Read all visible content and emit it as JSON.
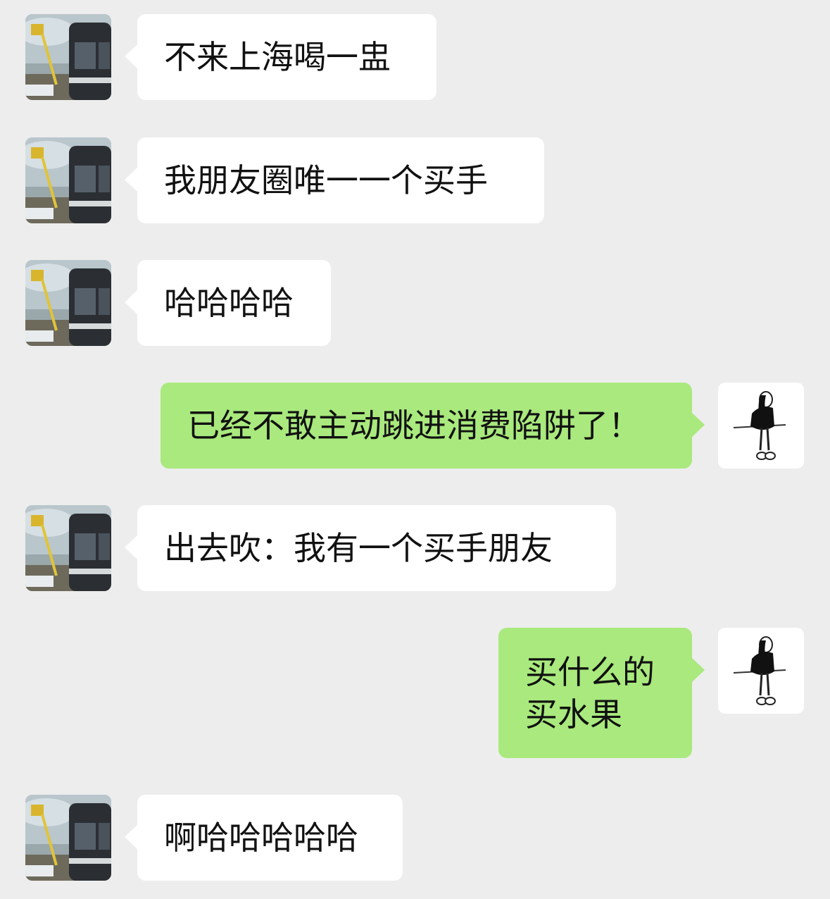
{
  "messages": [
    {
      "sender": "friend",
      "text": "不来上海喝一盅"
    },
    {
      "sender": "friend",
      "text": "我朋友圈唯一一个买手"
    },
    {
      "sender": "friend",
      "text": "哈哈哈哈"
    },
    {
      "sender": "me",
      "text": "已经不敢主动跳进消费陷阱了！"
    },
    {
      "sender": "friend",
      "text": "出去吹：我有一个买手朋友"
    },
    {
      "sender": "me",
      "text": "买什么的\n买水果"
    },
    {
      "sender": "friend",
      "text": "啊哈哈哈哈哈"
    }
  ],
  "avatars": {
    "friend": "bus-photo-avatar",
    "me": "girl-sketch-avatar"
  },
  "colors": {
    "background": "#ededed",
    "incoming_bubble": "#ffffff",
    "outgoing_bubble": "#a9e97d"
  }
}
